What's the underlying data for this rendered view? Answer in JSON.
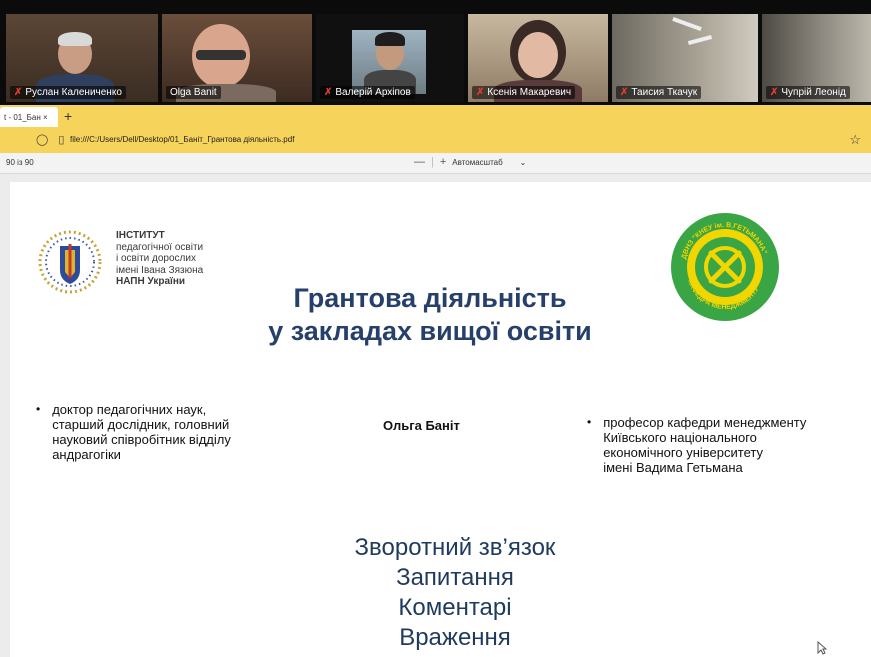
{
  "participants": [
    {
      "name": "Руслан Калениченко",
      "muted": true
    },
    {
      "name": "Olga Banit",
      "muted": false,
      "active": true
    },
    {
      "name": "Валерій Архіпов",
      "muted": true
    },
    {
      "name": "Ксенія Макаревич",
      "muted": true
    },
    {
      "name": "Таисия Ткачук",
      "muted": true
    },
    {
      "name": "Чупрій Леонід",
      "muted": true
    }
  ],
  "browser": {
    "tab_title": "t - 01_Бан ×",
    "new_tab": "+",
    "url": "file:///C:/Users/Dell/Desktop/01_Баніт_Грантова діяльність.pdf"
  },
  "pdf_toolbar": {
    "page_field": "90",
    "page_total": "із 90",
    "zoom_out": "—",
    "zoom_in": "+",
    "zoom_label": "Автомасштаб"
  },
  "slide": {
    "institute": {
      "line1": "ІНСТИТУТ",
      "line2": "педагогічної освіти",
      "line3": "і освіти дорослих",
      "line4": "імені Івана Зязюна",
      "line5": "НАПН України"
    },
    "department_logo_text": {
      "top": "ДВНЗ \"КНЕУ ім. В.ГЕТЬМАНА\"",
      "bottom": "КАФЕДРА МЕНЕДЖМЕНТУ"
    },
    "title_line1": "Грантова діяльність",
    "title_line2": "у закладах вищої освіти",
    "speaker": "Ольга Баніт",
    "left_bullet": {
      "l1": "доктор педагогічних наук,",
      "l2": "старший дослідник, головний",
      "l3": "науковий співробітник відділу",
      "l4": "андрагогіки"
    },
    "right_bullet": {
      "l1": "професор кафедри менеджменту",
      "l2": "Київського національного",
      "l3": "економічного університету",
      "l4": "імені Вадима Гетьмана"
    },
    "feedback": {
      "l1": "Зворотний зв’язок",
      "l2": "Запитання",
      "l3": "Коментарі",
      "l4": "Враження"
    }
  },
  "colors": {
    "browser_chrome": "#f6d35a",
    "active_speaker": "#2ecc71",
    "title": "#26406b",
    "feedback": "#1f3a5f",
    "logo_green": "#3aa545",
    "logo_yellow": "#f2d600",
    "muted_mic": "#e23b2e"
  }
}
